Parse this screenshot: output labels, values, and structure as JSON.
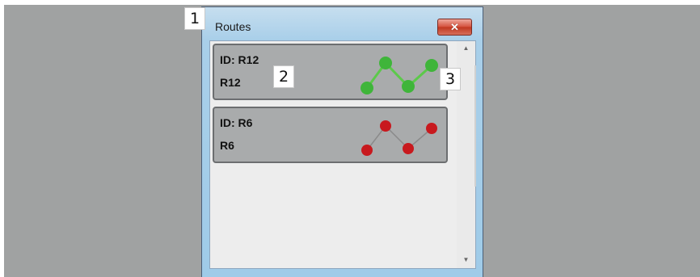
{
  "window": {
    "title": "Routes",
    "close_label": "✕"
  },
  "callouts": [
    "1",
    "2",
    "3"
  ],
  "routes": [
    {
      "id_label": "ID: R12",
      "name": "R12",
      "color": "#3fb53a",
      "line": "#5cc94a"
    },
    {
      "id_label": "ID: R6",
      "name": "R6",
      "color": "#c8191e",
      "line": "#8a8a8a"
    }
  ],
  "scroll": {
    "up_icon": "▲",
    "down_icon": "▼"
  }
}
